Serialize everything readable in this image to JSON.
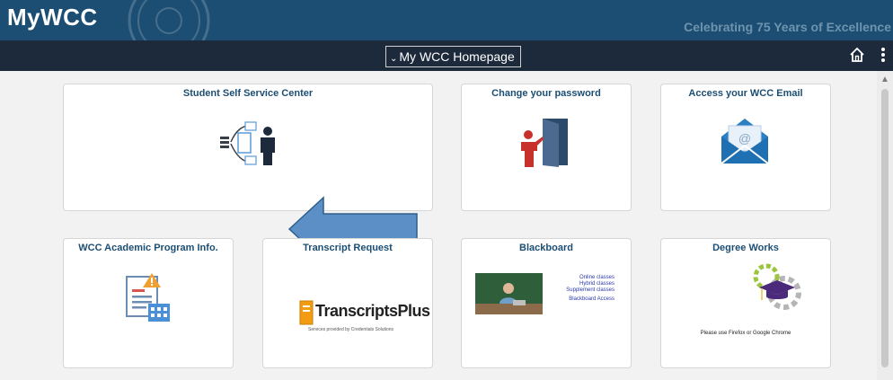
{
  "header": {
    "brand": "MyWCC",
    "tagline": "Celebrating 75 Years of Excellence"
  },
  "nav": {
    "homepage_label": "My WCC Homepage",
    "home_icon": "home-icon",
    "more_icon": "more-vertical-icon"
  },
  "tiles": [
    {
      "title": "Student Self Service Center",
      "icon": "self-service-icon"
    },
    {
      "title": "Change your password",
      "icon": "door-person-icon"
    },
    {
      "title": "Access your WCC Email",
      "icon": "envelope-icon"
    },
    {
      "title": "WCC Academic Program Info.",
      "icon": "program-info-icon"
    },
    {
      "title": "Transcript Request",
      "icon": "transcriptsplus-logo",
      "logo_text": "TranscriptsPlus",
      "logo_sub": "Services provided by Credentials Solutions"
    },
    {
      "title": "Blackboard",
      "icon": "blackboard-image",
      "links": [
        "Online classes",
        "Hybrid classes",
        "Supplement classes",
        "Blackboard Access"
      ]
    },
    {
      "title": "Degree Works",
      "icon": "degree-works-icon",
      "note": "Please use Firefox or Google Chrome"
    }
  ],
  "colors": {
    "banner": "#1c4e73",
    "navbar": "#1d2a3b",
    "tile_title": "#1c4e73",
    "arrow": "#5b8fc6"
  }
}
